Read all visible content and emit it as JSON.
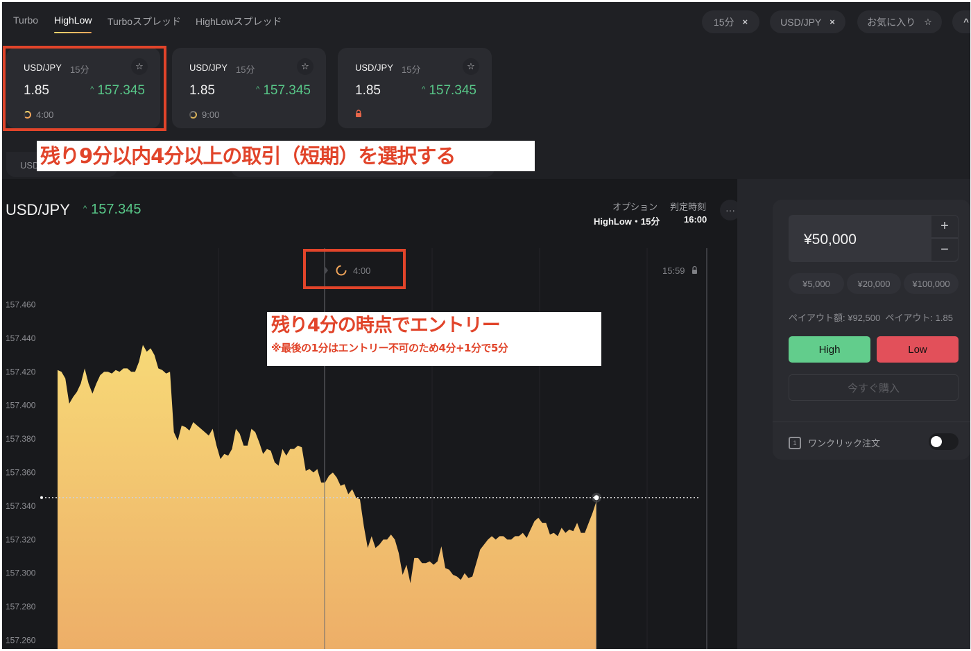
{
  "tabs": [
    {
      "label": "Turbo",
      "active": false
    },
    {
      "label": "HighLow",
      "active": true
    },
    {
      "label": "Turboスプレッド",
      "active": false
    },
    {
      "label": "HighLowスプレッド",
      "active": false
    }
  ],
  "filters": {
    "duration": "15分",
    "pair": "USD/JPY",
    "favorites": "お気に入り",
    "close_icon": "×",
    "star_icon": "☆",
    "collapse_icon": "^"
  },
  "cards": [
    {
      "pair": "USD/JPY",
      "duration": "15分",
      "payout": "1.85",
      "price": "157.345",
      "direction": "up",
      "timer": "4:00",
      "status": "timer"
    },
    {
      "pair": "USD/JPY",
      "duration": "15分",
      "payout": "1.85",
      "price": "157.345",
      "direction": "up",
      "timer": "9:00",
      "status": "timer"
    },
    {
      "pair": "USD/JPY",
      "duration": "15分",
      "payout": "1.85",
      "price": "157.345",
      "direction": "up",
      "timer": "",
      "status": "locked"
    }
  ],
  "row2_label": "USD",
  "annotations": {
    "banner1": "残り9分以内4分以上の取引（短期）を選択する",
    "banner2_title": "残り4分の時点でエントリー",
    "banner2_note": "※最後の1分はエントリー不可のため4分+1分で5分"
  },
  "main": {
    "pair": "USD/JPY",
    "price": "157.345",
    "option_label": "オプション",
    "option_value": "HighLow・15分",
    "expiry_label": "判定時刻",
    "expiry_value": "16:00",
    "more_icon": "···"
  },
  "chart_data": {
    "type": "area",
    "title": "USD/JPY",
    "xlabel": "",
    "ylabel": "",
    "ylim": [
      157.254,
      157.473
    ],
    "yticks": [
      "157.460",
      "157.440",
      "157.420",
      "157.400",
      "157.380",
      "157.360",
      "157.340",
      "157.320",
      "157.300",
      "157.280",
      "157.260"
    ],
    "current_price": 157.345,
    "markers": [
      {
        "label": "4:00",
        "type": "entry-timer"
      },
      {
        "label": "15:59",
        "type": "entry-close",
        "locked": true
      }
    ],
    "colors": {
      "fill_top": "#f7d977",
      "fill_bottom": "#edae68"
    },
    "series": [
      {
        "name": "price",
        "values": [
          157.421,
          157.42,
          157.416,
          157.401,
          157.405,
          157.408,
          157.413,
          157.422,
          157.413,
          157.407,
          157.413,
          157.418,
          157.42,
          157.42,
          157.419,
          157.421,
          157.42,
          157.422,
          157.422,
          157.42,
          157.42,
          157.426,
          157.436,
          157.432,
          157.434,
          157.43,
          157.422,
          157.421,
          157.419,
          157.42,
          157.384,
          157.379,
          157.388,
          157.387,
          157.385,
          157.39,
          157.388,
          157.386,
          157.384,
          157.382,
          157.386,
          157.376,
          157.368,
          157.371,
          157.37,
          157.374,
          157.386,
          157.383,
          157.376,
          157.376,
          157.386,
          157.384,
          157.378,
          157.371,
          157.374,
          157.373,
          157.366,
          157.364,
          157.374,
          157.37,
          157.374,
          157.374,
          157.376,
          157.375,
          157.361,
          157.362,
          157.36,
          157.362,
          157.354,
          157.354,
          157.358,
          157.36,
          157.357,
          157.352,
          157.353,
          157.347,
          157.35,
          157.345,
          157.344,
          157.328,
          157.315,
          157.322,
          157.315,
          157.317,
          157.32,
          157.32,
          157.323,
          157.32,
          157.312,
          157.299,
          157.305,
          157.294,
          157.309,
          157.309,
          157.306,
          157.306,
          157.307,
          157.305,
          157.307,
          157.316,
          157.303,
          157.302,
          157.299,
          157.298,
          157.296,
          157.3,
          157.297,
          157.298,
          157.306,
          157.314,
          157.317,
          157.32,
          157.322,
          157.32,
          157.322,
          157.322,
          157.32,
          157.32,
          157.322,
          157.322,
          157.324,
          157.321,
          157.326,
          157.331,
          157.333,
          157.33,
          157.33,
          157.323,
          157.324,
          157.322,
          157.327,
          157.324,
          157.326,
          157.325,
          157.33,
          157.324,
          157.324,
          157.33,
          157.336,
          157.343
        ]
      }
    ]
  },
  "trade_panel": {
    "amount": "¥50,000",
    "plus_icon": "+",
    "minus_icon": "−",
    "quick_amounts": [
      "¥5,000",
      "¥20,000",
      "¥100,000"
    ],
    "payout_amount_label": "ペイアウト額: ¥92,500",
    "payout_rate_label": "ペイアウト: 1.85",
    "high_label": "High",
    "low_label": "Low",
    "buy_now_label": "今すぐ購入",
    "oneclick_label": "ワンクリック注文",
    "oneclick_icon_text": "1",
    "oneclick_enabled": false,
    "colors": {
      "high": "#62cd8c",
      "low": "#e2505a"
    }
  }
}
